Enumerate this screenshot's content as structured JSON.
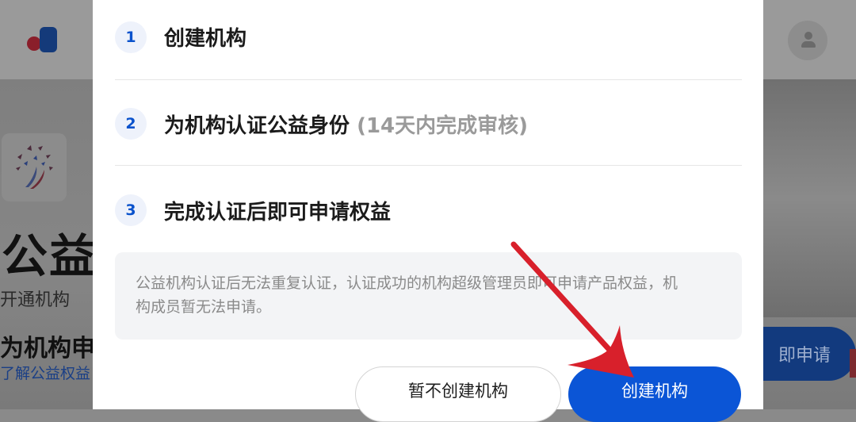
{
  "background": {
    "hero_title": "公益",
    "hero_subtitle": "开通机构",
    "section_title": "为机构申",
    "learn_link": "了解公益权益",
    "apply_button": "即申请"
  },
  "modal": {
    "steps": [
      {
        "number": "1",
        "label": "创建机构",
        "note": ""
      },
      {
        "number": "2",
        "label": "为机构认证公益身份",
        "note": "(14天内完成审核)"
      },
      {
        "number": "3",
        "label": "完成认证后即可申请权益",
        "note": ""
      }
    ],
    "notice_line1": "公益机构认证后无法重复认证，认证成功的机构超级管理员即可申请产品权益，机",
    "notice_line2": "构成员暂无法申请。",
    "cancel_label": "暂不创建机构",
    "create_label": "创建机构"
  },
  "colors": {
    "primary": "#0b55d6",
    "step_badge_bg": "#eef2fb",
    "annotation_arrow": "#d8202b"
  }
}
